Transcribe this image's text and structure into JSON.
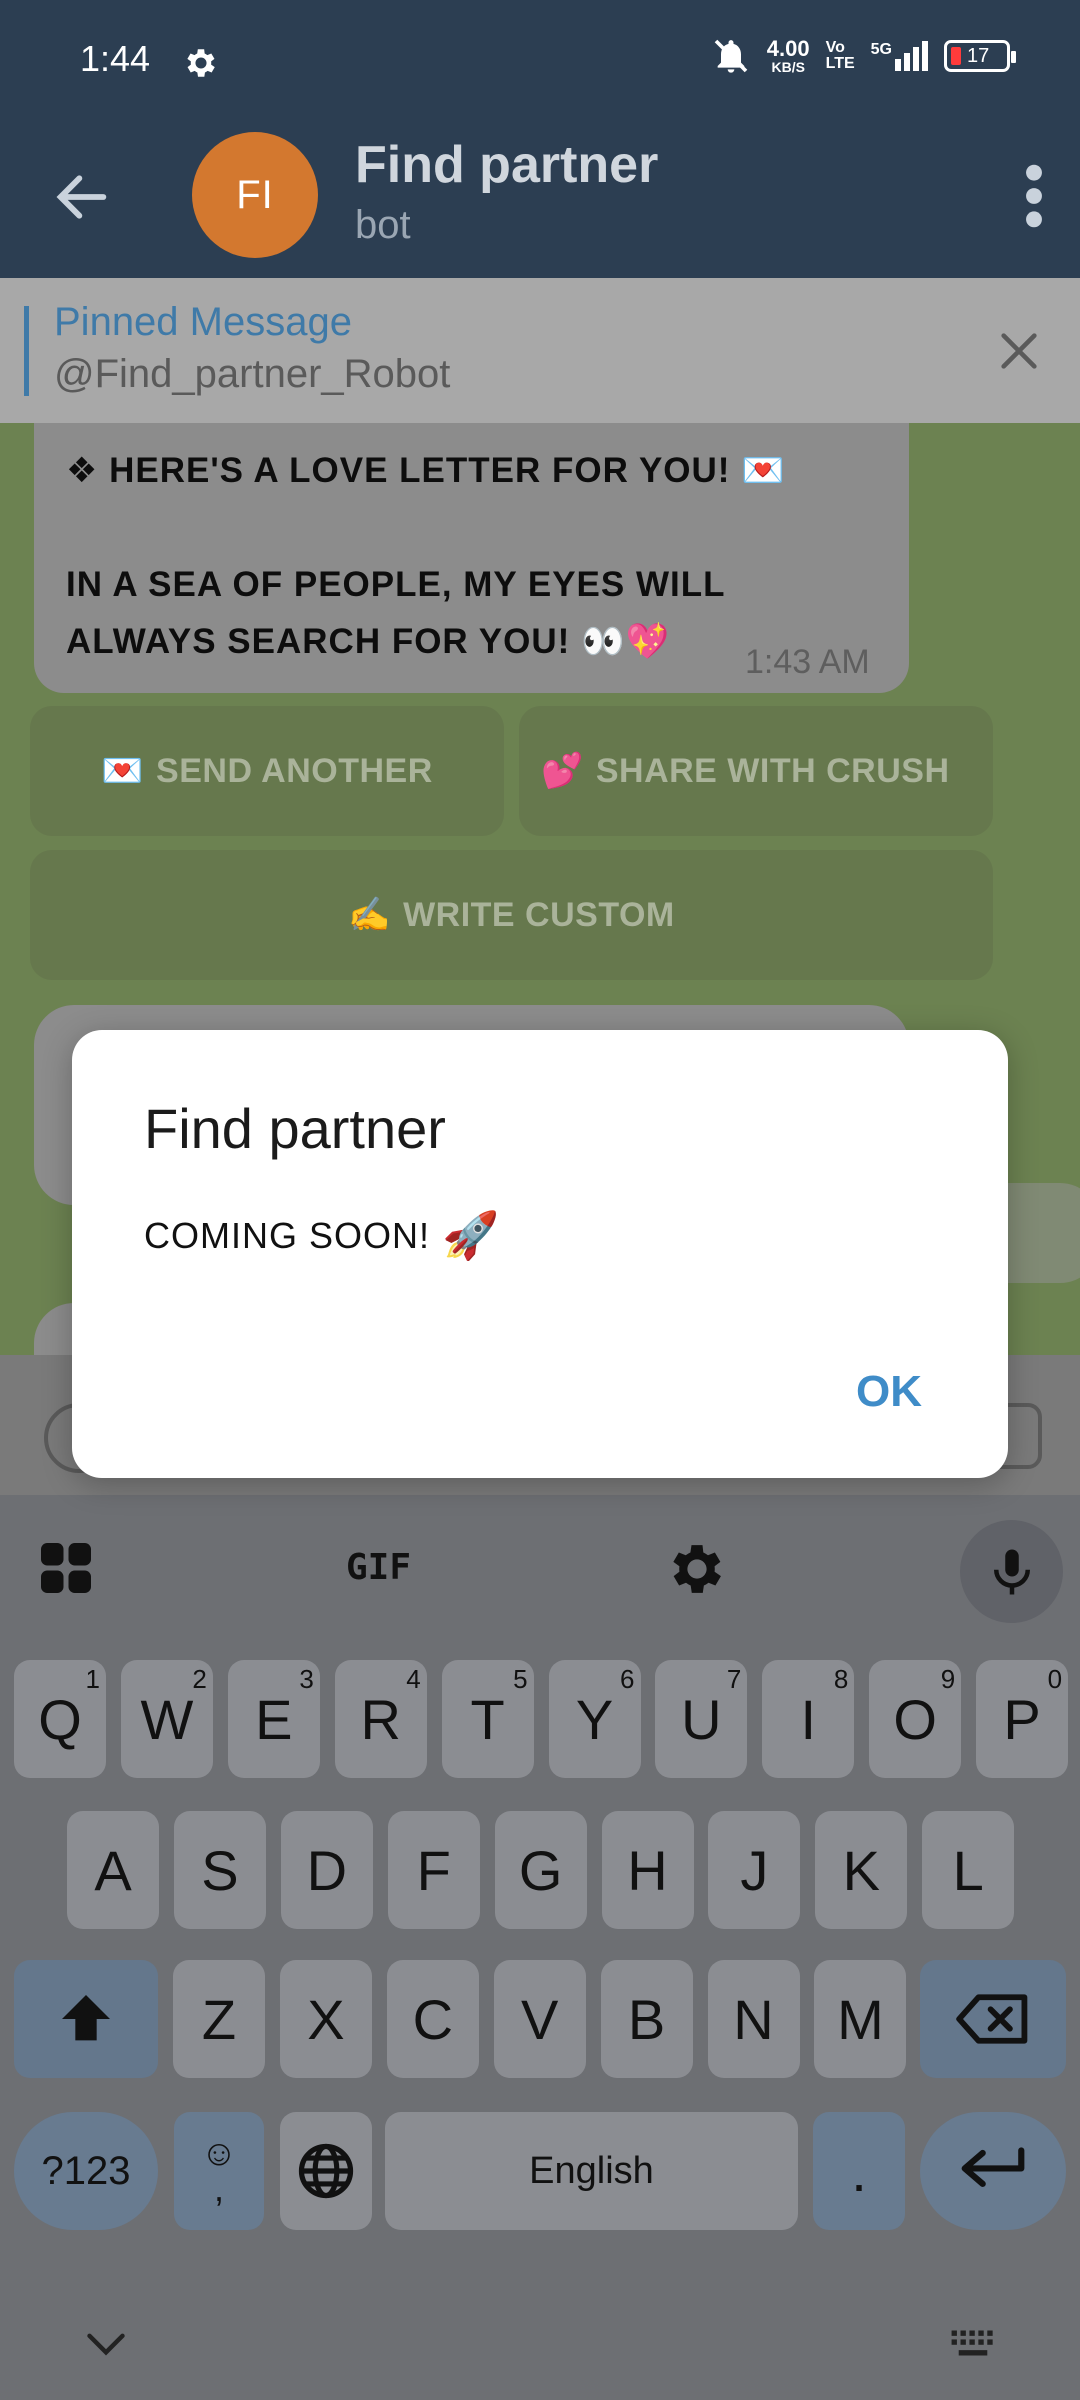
{
  "status_bar": {
    "time": "1:44",
    "net_speed": "4.00",
    "net_unit": "KB/S",
    "volte_top": "Vo",
    "volte_bottom": "LTE",
    "network": "5G",
    "battery": "17"
  },
  "header": {
    "avatar_initials": "FI",
    "title": "Find partner",
    "subtitle": "bot"
  },
  "pinned": {
    "title": "Pinned Message",
    "text": "@Find_partner_Robot"
  },
  "message": {
    "line1": "❖ HERE'S A LOVE LETTER FOR YOU! 💌",
    "line2": "IN A SEA OF PEOPLE, MY EYES WILL",
    "line3": "ALWAYS SEARCH FOR YOU! 👀💖",
    "time": "1:43 AM"
  },
  "inline_buttons": [
    {
      "emoji": "💌",
      "label": "SEND ANOTHER"
    },
    {
      "emoji": "💕",
      "label": "SHARE WITH CRUSH"
    },
    {
      "emoji": "✍️",
      "label": "WRITE CUSTOM"
    }
  ],
  "dialog": {
    "title": "Find partner",
    "message": "COMING SOON!",
    "emoji": "🚀",
    "ok_label": "OK"
  },
  "keyboard": {
    "gif_label": "GIF",
    "row1": [
      {
        "k": "Q",
        "n": "1"
      },
      {
        "k": "W",
        "n": "2"
      },
      {
        "k": "E",
        "n": "3"
      },
      {
        "k": "R",
        "n": "4"
      },
      {
        "k": "T",
        "n": "5"
      },
      {
        "k": "Y",
        "n": "6"
      },
      {
        "k": "U",
        "n": "7"
      },
      {
        "k": "I",
        "n": "8"
      },
      {
        "k": "O",
        "n": "9"
      },
      {
        "k": "P",
        "n": "0"
      }
    ],
    "row2": [
      "A",
      "S",
      "D",
      "F",
      "G",
      "H",
      "J",
      "K",
      "L"
    ],
    "row3": [
      "Z",
      "X",
      "C",
      "V",
      "B",
      "N",
      "M"
    ],
    "symbols_label": "?123",
    "emoji_top": "☺",
    "emoji_bottom": ",",
    "space_label": "English",
    "period_label": "."
  }
}
